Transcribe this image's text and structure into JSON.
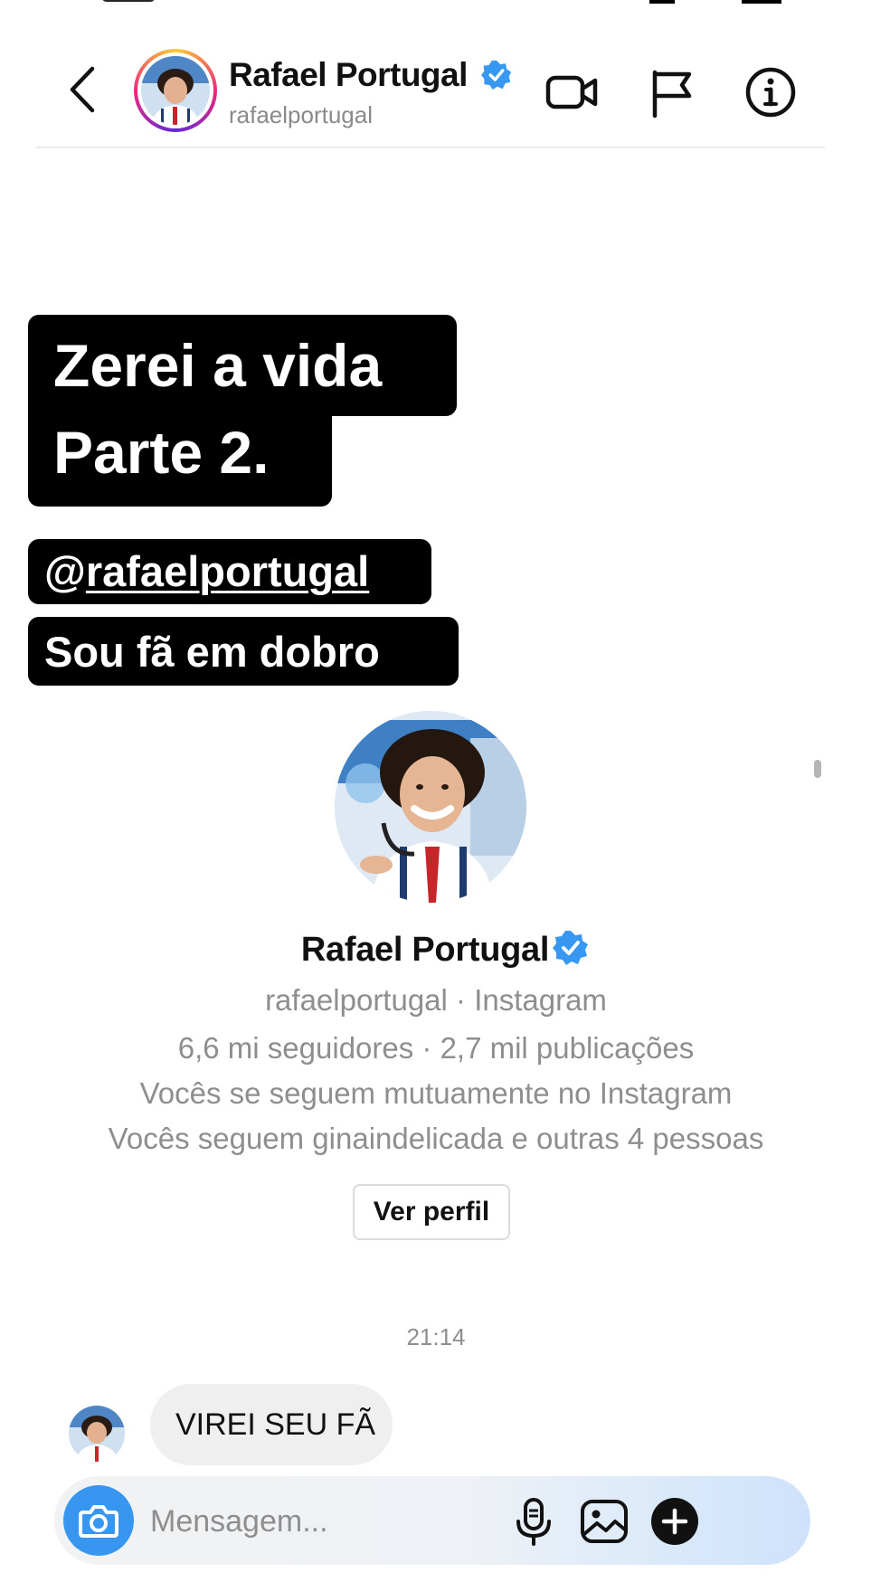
{
  "header": {
    "name": "Rafael Portugal",
    "username": "rafaelportugal"
  },
  "story": {
    "line1": "Zerei a vida",
    "line2": "Parte 2.",
    "mention_at": "@",
    "mention_user": "rafaelportugal",
    "line4": "Sou fã em dobro"
  },
  "profile_card": {
    "name": "Rafael Portugal",
    "source": "rafaelportugal · Instagram",
    "stats": "6,6 mi seguidores · 2,7 mil publicações",
    "mutual": "Vocês se seguem mutuamente no Instagram",
    "followed_by": "Vocês seguem ginaindelicada e outras 4 pessoas",
    "button": "Ver perfil"
  },
  "thread": {
    "timestamp": "21:14",
    "message": "VIREI SEU FÃ"
  },
  "composer": {
    "placeholder": "Mensagem..."
  },
  "colors": {
    "accent": "#3797f0",
    "verified": "#3897f0"
  }
}
